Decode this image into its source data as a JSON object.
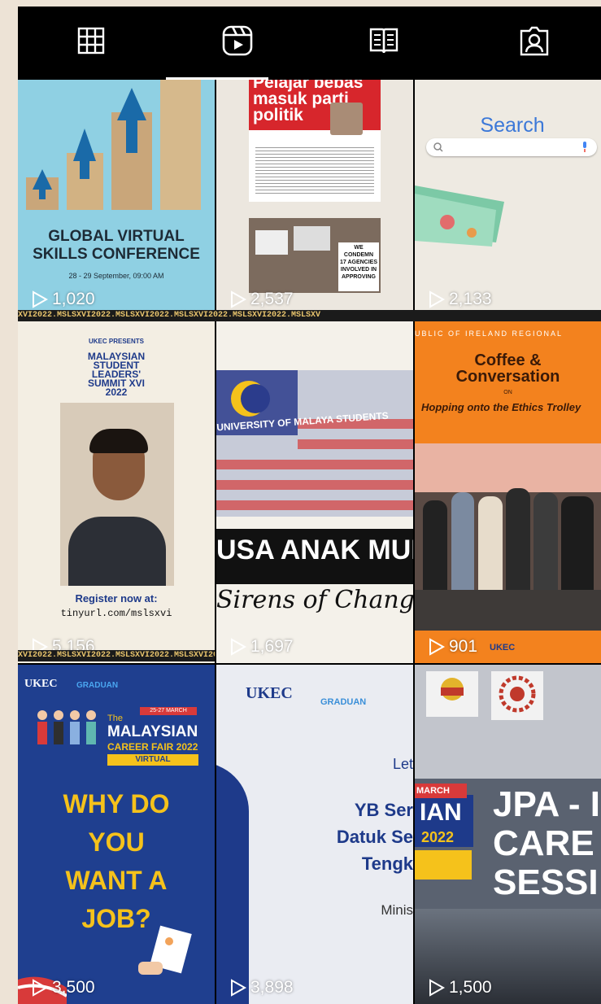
{
  "tabs": [
    {
      "name": "grid",
      "icon": "grid-icon"
    },
    {
      "name": "reels",
      "icon": "reels-icon",
      "active": true
    },
    {
      "name": "guides",
      "icon": "guide-icon"
    },
    {
      "name": "tagged",
      "icon": "tagged-person-icon"
    }
  ],
  "strip_text": "XVI2022.MSLSXVI2022.MSLSXVI2022.MSLSXVI2022.MSLSXVI2022.MSLSXV",
  "tiles": [
    {
      "views": "1,020",
      "title": "GLOBAL VIRTUAL\nSKILLS CONFERENCE",
      "subtitle": "28 - 29 September, 09:00 AM"
    },
    {
      "views": "2,537",
      "headline": "Pelajar bebas\nmasuk parti\npolitik",
      "protest_signs": [
        "WE",
        "CONDEMN",
        "17 AGENCIES",
        "INVOLVED IN",
        "APPROVING"
      ]
    },
    {
      "views": "2,133",
      "search_label": "Search"
    },
    {
      "views": "5,156",
      "brand": "UKEC PRESENTS",
      "title": "MALAYSIAN\nSTUDENT\nLEADERS'\nSUMMIT XVI\n2022",
      "cta": "Register now at:",
      "url": "tinyurl.com/mslsxvi"
    },
    {
      "views": "1,697",
      "banner": "UNIVERSITY OF MALAYA STUDENTS",
      "headline": "USA ANAK MUD",
      "script": "Sirens of Change"
    },
    {
      "views": "901",
      "org": "UBLIC OF IRELAND REGIONAL",
      "title": "Coffee &\nConversation",
      "on": "ON",
      "topic": "Hopping onto the Ethics Trolley",
      "brand": "UKEC"
    },
    {
      "views": "3,500",
      "brand": "UKEC",
      "brand2": "GRADUAN",
      "dates": "25-27 MARCH",
      "the": "The",
      "fair": "MALAYSIAN",
      "fair2": "CAREER FAIR 2022",
      "virtual": "VIRTUAL",
      "question": "WHY DO\nYOU\nWANT A\nJOB?"
    },
    {
      "views": "3,898",
      "brand": "UKEC",
      "brand2": "GRADUAN",
      "let": "Let",
      "speaker": "YB Ser\nDatuk Se\nTengk",
      "role": "Minis"
    },
    {
      "views": "1,500",
      "march": "MARCH",
      "ian": "IAN",
      "year": "2022",
      "title": "JPA - I\nCARE\nSESSI"
    }
  ],
  "colors": {
    "accent_blue": "#2f7fd8",
    "poster_navy": "#1e3a8a",
    "poster_yellow": "#f5c21b",
    "coffee_orange": "#f3821e"
  }
}
